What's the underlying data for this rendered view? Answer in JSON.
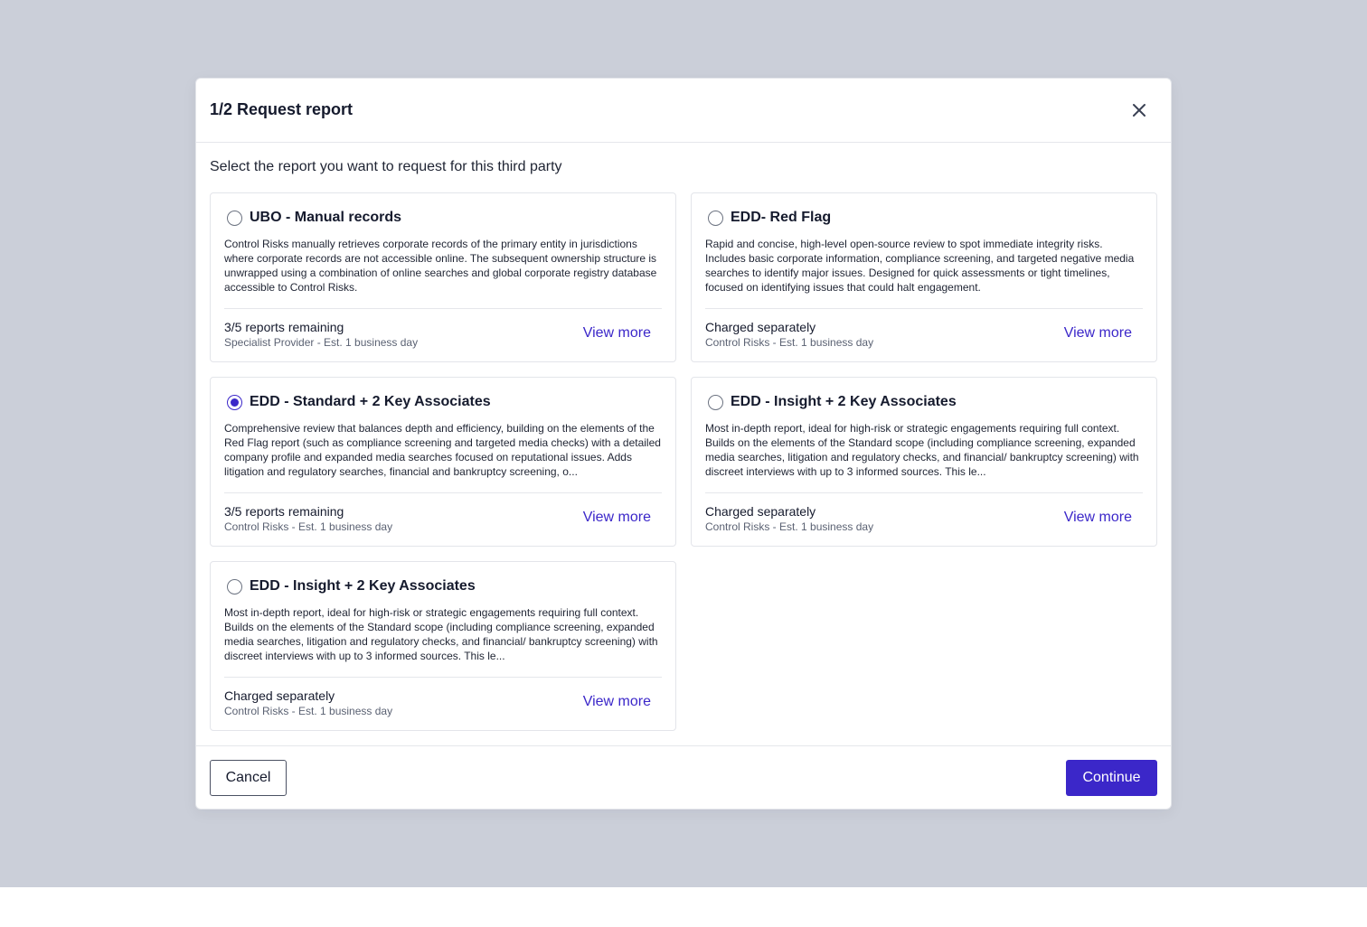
{
  "modal": {
    "title": "1/2 Request report",
    "subtitle": "Select the report you want to request for this third party"
  },
  "cards": [
    {
      "title": "UBO - Manual records",
      "selected": false,
      "description": "Control Risks manually retrieves corporate records of the primary entity in jurisdictions where corporate records are not accessible online. The subsequent ownership structure is unwrapped using a combination of online searches and global corporate registry database accessible to Control Risks.",
      "status": "3/5 reports remaining",
      "provider": "Specialist Provider - Est. 1 business day",
      "view_more": "View more"
    },
    {
      "title": "EDD- Red Flag",
      "selected": false,
      "description": "Rapid and concise, high-level open-source review to spot immediate integrity risks. Includes basic corporate information, compliance screening, and targeted negative media searches to identify major issues. Designed for quick assessments or tight timelines, focused on identifying issues that could halt engagement.",
      "status": "Charged separately",
      "provider": "Control Risks - Est. 1 business day",
      "view_more": "View more"
    },
    {
      "title": "EDD - Standard + 2 Key Associates",
      "selected": true,
      "description": "Comprehensive review that balances depth and efficiency, building on the elements of the Red Flag report (such as compliance screening and targeted media checks) with a detailed company profile and expanded media searches focused on reputational issues. Adds litigation and regulatory searches, financial and bankruptcy screening, o...",
      "status": "3/5 reports remaining",
      "provider": "Control Risks - Est. 1 business day",
      "view_more": "View more"
    },
    {
      "title": "EDD - Insight + 2 Key Associates",
      "selected": false,
      "description": "Most in-depth report, ideal for high-risk or strategic engagements requiring full context. Builds on the elements of the Standard scope (including compliance screening, expanded media searches, litigation and regulatory checks, and financial/ bankruptcy screening) with discreet interviews with up to 3 informed sources. This le...",
      "status": "Charged separately",
      "provider": "Control Risks - Est. 1 business day",
      "view_more": "View more"
    },
    {
      "title": "EDD - Insight + 2 Key Associates",
      "selected": false,
      "description": "Most in-depth report, ideal for high-risk or strategic engagements requiring full context. Builds on the elements of the Standard scope (including compliance screening, expanded media searches, litigation and regulatory checks, and financial/ bankruptcy screening) with discreet interviews with up to 3 informed sources. This le...",
      "status": "Charged separately",
      "provider": "Control Risks - Est. 1 business day",
      "view_more": "View more"
    }
  ],
  "footer": {
    "cancel_label": "Cancel",
    "continue_label": "Continue"
  },
  "colors": {
    "accent": "#3b27c9",
    "backdrop": "#cbcfd9"
  },
  "icons": {
    "close": "close-icon"
  }
}
